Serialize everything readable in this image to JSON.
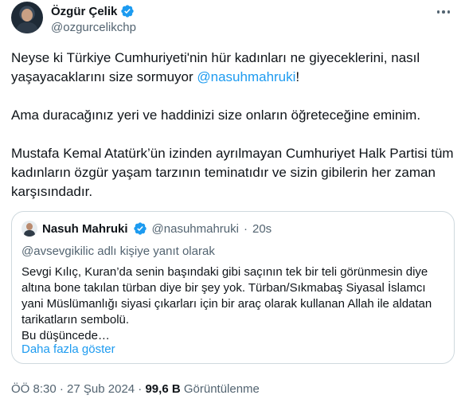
{
  "author": {
    "name": "Özgür Çelik",
    "handle": "@ozgurcelikchp",
    "verified_color": "#1d9bf0"
  },
  "tweet": {
    "p1_text": "Neyse ki Türkiye Cumhuriyeti'nin hür kadınları ne giyeceklerini, nasıl yaşayacaklarını size sormuyor ",
    "p1_mention": "@nasuhmahruki",
    "p1_end": "!",
    "p2": "Ama duracağınız yeri ve haddinizi size onların öğreteceğine eminim.",
    "p3": "Mustafa Kemal Atatürk’ün izinden ayrılmayan Cumhuriyet Halk Partisi tüm kadınların özgür yaşam tarzının teminatıdır ve sizin gibilerin her zaman karşısındadır."
  },
  "quote": {
    "name": "Nasuh Mahruki",
    "handle": "@nasuhmahruki",
    "dot": "·",
    "time": "20s",
    "reply_context": "@avsevgikilic adlı kişiye yanıt olarak",
    "text": "Sevgi Kılıç, Kuran’da senin başındaki gibi saçının tek bir teli görünmesin diye altına bone takılan türban diye bir şey yok. Türban/Sıkmabaş Siyasal İslamcı yani Müslümanlığı siyasi çıkarları için bir araç olarak kullanan Allah ile aldatan tarikatların sembolü.",
    "text_end": "Bu düşüncede…",
    "show_more": "Daha fazla göster"
  },
  "meta": {
    "time": "ÖÖ 8:30",
    "sep1": "·",
    "date": "27 Şub 2024",
    "sep2": "·",
    "views": "99,6 B",
    "views_label": "Görüntülenme"
  },
  "colors": {
    "link": "#1d9bf0",
    "secondary": "#536471",
    "border": "#cfd9de"
  }
}
